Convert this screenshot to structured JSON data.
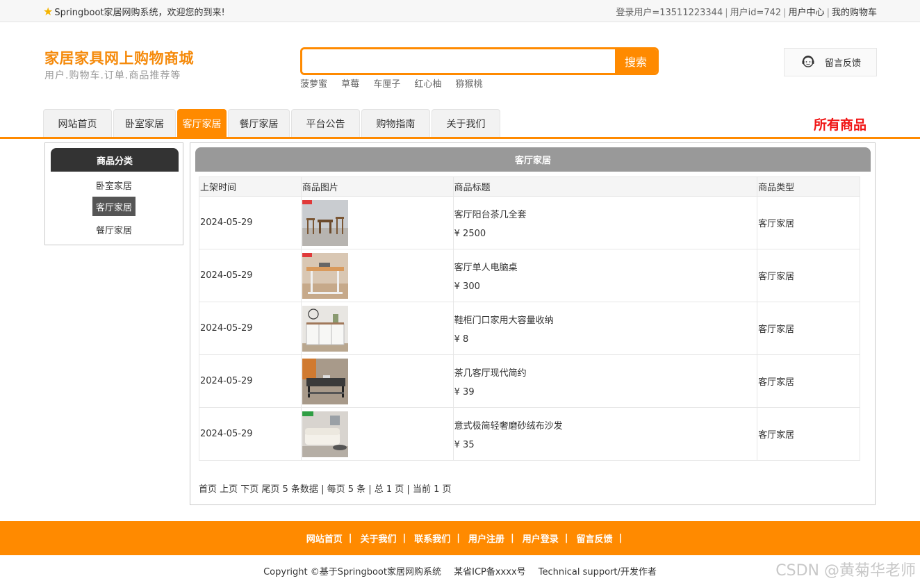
{
  "topbar": {
    "welcome": "Springboot家居网购系统，欢迎您的到来!",
    "login_user": "登录用户=13511223344",
    "user_id": "用户id=742",
    "user_center": "用户中心",
    "cart": "我的购物车",
    "separator": "|"
  },
  "header": {
    "title": "家居家具网上购物商城",
    "subtitle": "用户.购物车.订单.商品推荐等",
    "search_value": "",
    "search_button": "搜索",
    "hot_words": [
      "菠萝蜜",
      "草莓",
      "车厘子",
      "红心柚",
      "猕猴桃"
    ],
    "feedback": "留言反馈"
  },
  "nav": {
    "tabs": [
      {
        "label": "网站首页",
        "active": false
      },
      {
        "label": "卧室家居",
        "active": false
      },
      {
        "label": "客厅家居",
        "active": true
      },
      {
        "label": "餐厅家居",
        "active": false
      },
      {
        "label": "平台公告",
        "active": false
      },
      {
        "label": "购物指南",
        "active": false
      },
      {
        "label": "关于我们",
        "active": false
      }
    ],
    "all_goods": "所有商品"
  },
  "sidebar": {
    "title": "商品分类",
    "items": [
      {
        "label": "卧室家居",
        "active": false
      },
      {
        "label": "客厅家居",
        "active": true
      },
      {
        "label": "餐厅家居",
        "active": false
      }
    ]
  },
  "main": {
    "title": "客厅家居",
    "columns": [
      "上架时间",
      "商品图片",
      "商品标题",
      "商品类型"
    ],
    "rows": [
      {
        "date": "2024-05-29",
        "title": "客厅阳台茶几全套",
        "price": "¥ 2500",
        "type": "客厅家居"
      },
      {
        "date": "2024-05-29",
        "title": "客厅单人电脑桌",
        "price": "¥ 300",
        "type": "客厅家居"
      },
      {
        "date": "2024-05-29",
        "title": "鞋柜门口家用大容量收纳",
        "price": "¥ 8",
        "type": "客厅家居"
      },
      {
        "date": "2024-05-29",
        "title": "茶几客厅现代简约",
        "price": "¥ 39",
        "type": "客厅家居"
      },
      {
        "date": "2024-05-29",
        "title": "意式极简轻奢磨砂绒布沙发",
        "price": "¥ 35",
        "type": "客厅家居"
      }
    ],
    "pager": "首页 上页 下页 尾页 5 条数据 | 每页 5 条 | 总 1 页 | 当前 1 页"
  },
  "footer": {
    "links": [
      "网站首页",
      "关于我们",
      "联系我们",
      "用户注册",
      "用户登录",
      "留言反馈"
    ],
    "bar": "|",
    "copyright": "Copyright ©基于Springboot家居网购系统",
    "icp": "某省ICP备xxxx号",
    "support": "Technical support/开发作者"
  },
  "watermark": "CSDN @黄菊华老师",
  "colors": {
    "accent": "#ff8a00",
    "title": "#f58a0b",
    "all_goods": "#f01414",
    "sidebar_head": "#333333",
    "main_head": "#999999"
  }
}
